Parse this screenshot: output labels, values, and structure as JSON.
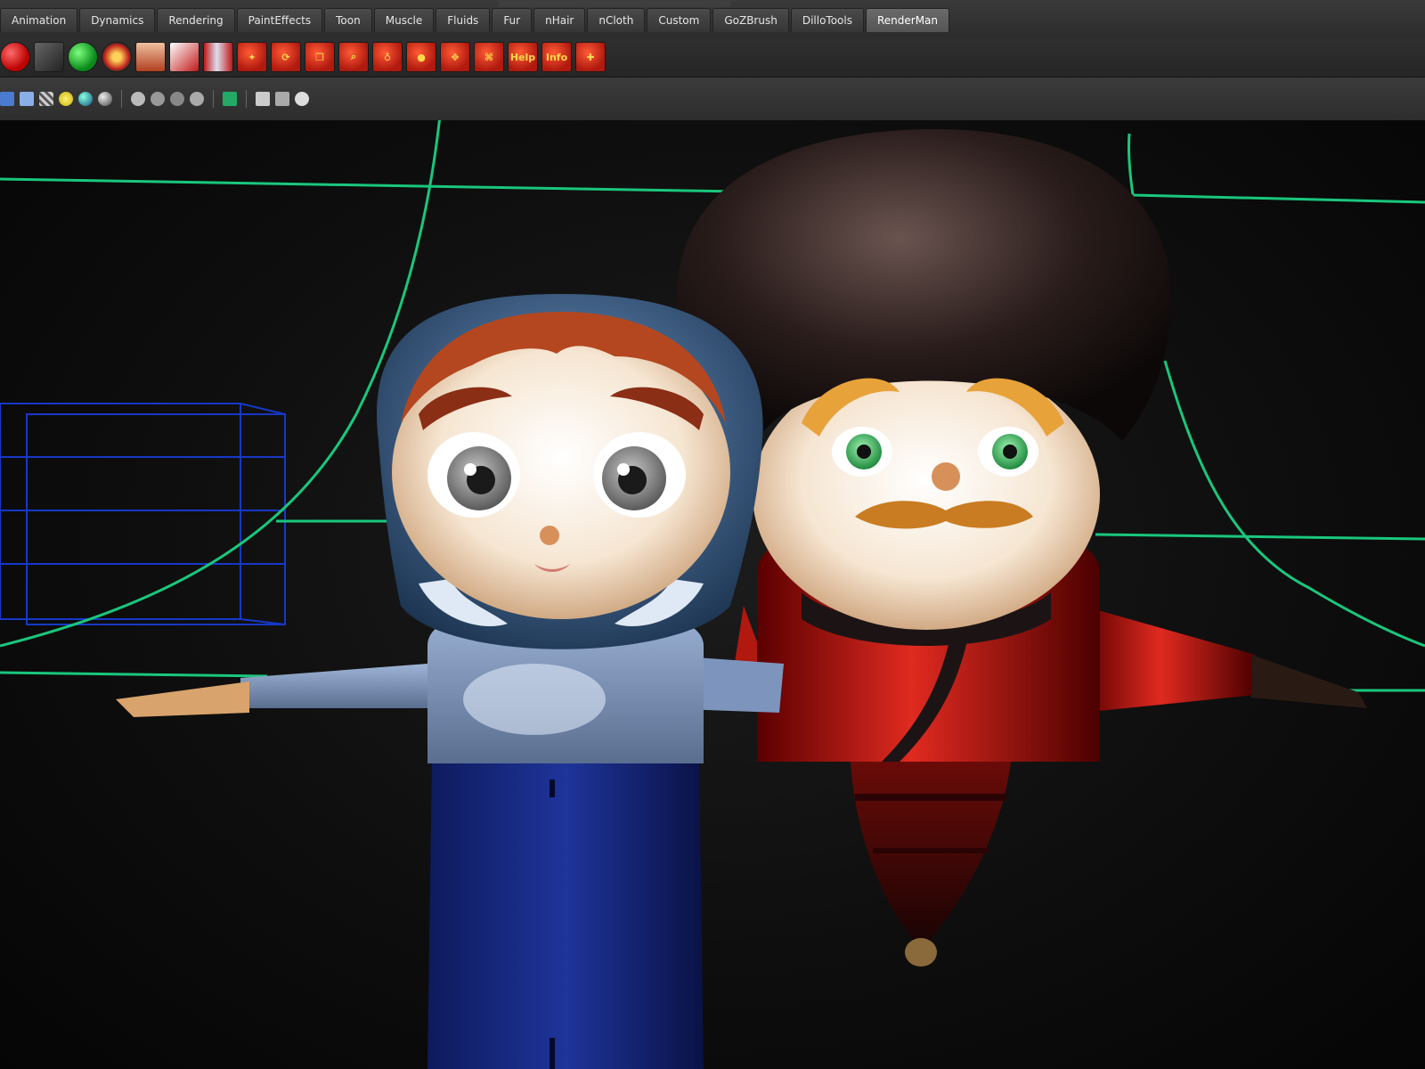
{
  "shelf": {
    "tabs": [
      {
        "label": "Animation"
      },
      {
        "label": "Dynamics"
      },
      {
        "label": "Rendering"
      },
      {
        "label": "PaintEffects"
      },
      {
        "label": "Toon"
      },
      {
        "label": "Muscle"
      },
      {
        "label": "Fluids"
      },
      {
        "label": "Fur"
      },
      {
        "label": "nHair"
      },
      {
        "label": "nCloth"
      },
      {
        "label": "Custom"
      },
      {
        "label": "GoZBrush"
      },
      {
        "label": "DilloTools"
      },
      {
        "label": "RenderMan"
      }
    ],
    "active_tab": "RenderMan",
    "icon_labels": {
      "help": "Help",
      "info": "Info"
    }
  },
  "colors": {
    "accent_active_tab": "#5f5f5f",
    "renderman_icon": "#c0231a",
    "curve_green": "#19c77d",
    "wire_blue": "#1638c8"
  },
  "icons": [
    "red-sphere-icon",
    "render-settings-icon",
    "green-sphere-icon",
    "shader-icon",
    "bowl-icon",
    "render-icon",
    "ipr-icon",
    "light-icon",
    "cycle-icon",
    "batch-icon",
    "render-view-icon",
    "attach-icon",
    "info-sphere-icon",
    "move-icon",
    "script-icon",
    "help-icon",
    "info-icon",
    "puzzle-icon"
  ]
}
